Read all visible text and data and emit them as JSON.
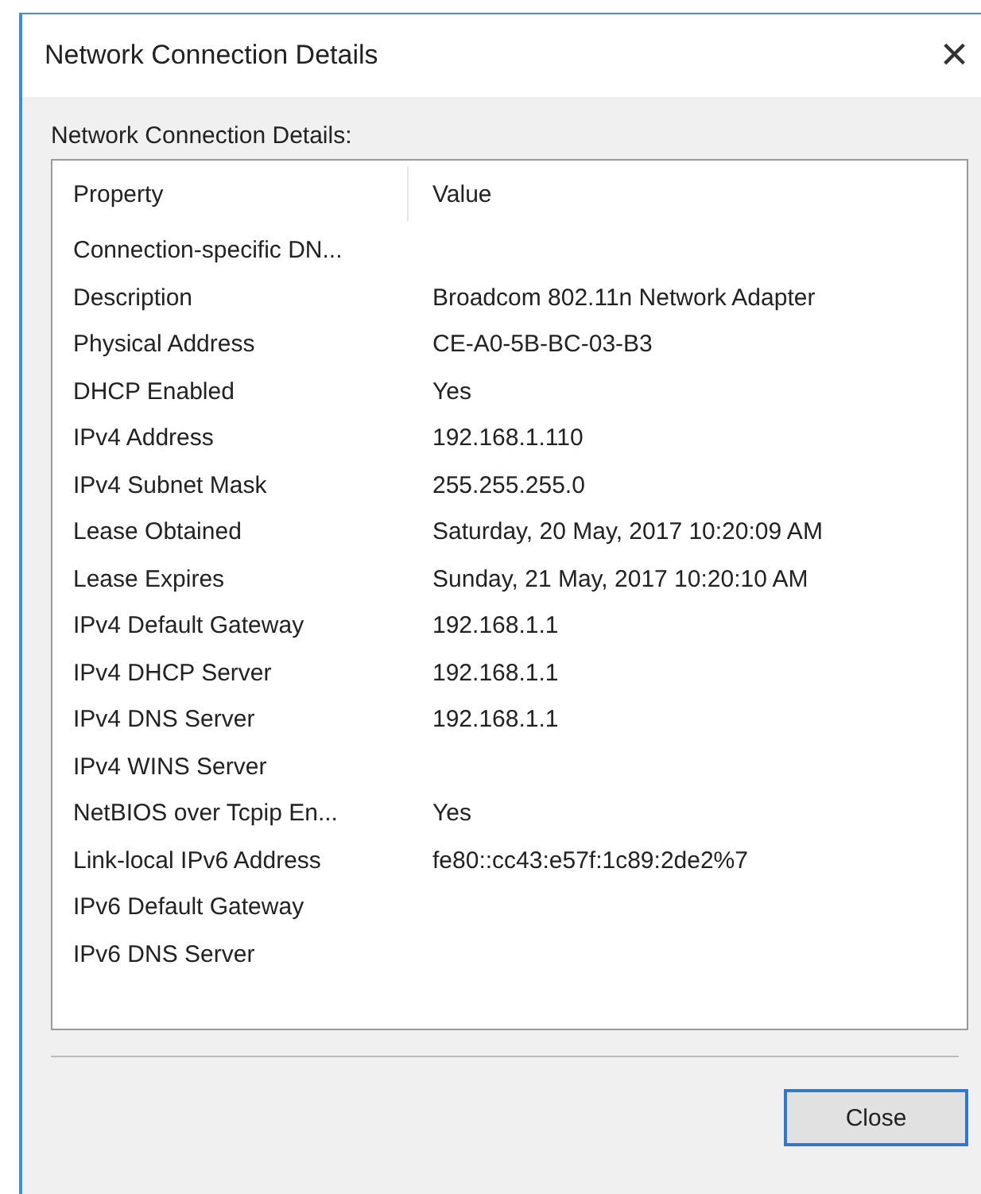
{
  "window": {
    "title": "Network Connection Details",
    "close_glyph": "×"
  },
  "group_label": "Network Connection Details:",
  "table": {
    "columns": [
      "Property",
      "Value"
    ],
    "rows": [
      {
        "property": "Connection-specific DN..."
      },
      {
        "property": "Description",
        "value": "Broadcom 802.11n Network Adapter"
      },
      {
        "property": "Physical Address",
        "value": "CE-A0-5B-BC-03-B3"
      },
      {
        "property": "DHCP Enabled",
        "value": "Yes"
      },
      {
        "property": "IPv4 Address",
        "value": "192.168.1.110"
      },
      {
        "property": "IPv4 Subnet Mask",
        "value": "255.255.255.0"
      },
      {
        "property": "Lease Obtained",
        "value": "Saturday, 20 May, 2017 10:20:09 AM"
      },
      {
        "property": "Lease Expires",
        "value": "Sunday, 21 May, 2017 10:20:10 AM"
      },
      {
        "property": "IPv4 Default Gateway",
        "value": "192.168.1.1"
      },
      {
        "property": "IPv4 DHCP Server",
        "value": "192.168.1.1"
      },
      {
        "property": "IPv4 DNS Server",
        "value": "192.168.1.1"
      },
      {
        "property": "IPv4 WINS Server"
      },
      {
        "property": "NetBIOS over Tcpip En...",
        "value": "Yes"
      },
      {
        "property": "Link-local IPv6 Address",
        "value": "fe80::cc43:e57f:1c89:2de2%7"
      },
      {
        "property": "IPv6 Default Gateway"
      },
      {
        "property": "IPv6 DNS Server"
      }
    ]
  },
  "buttons": [
    "Close"
  ]
}
